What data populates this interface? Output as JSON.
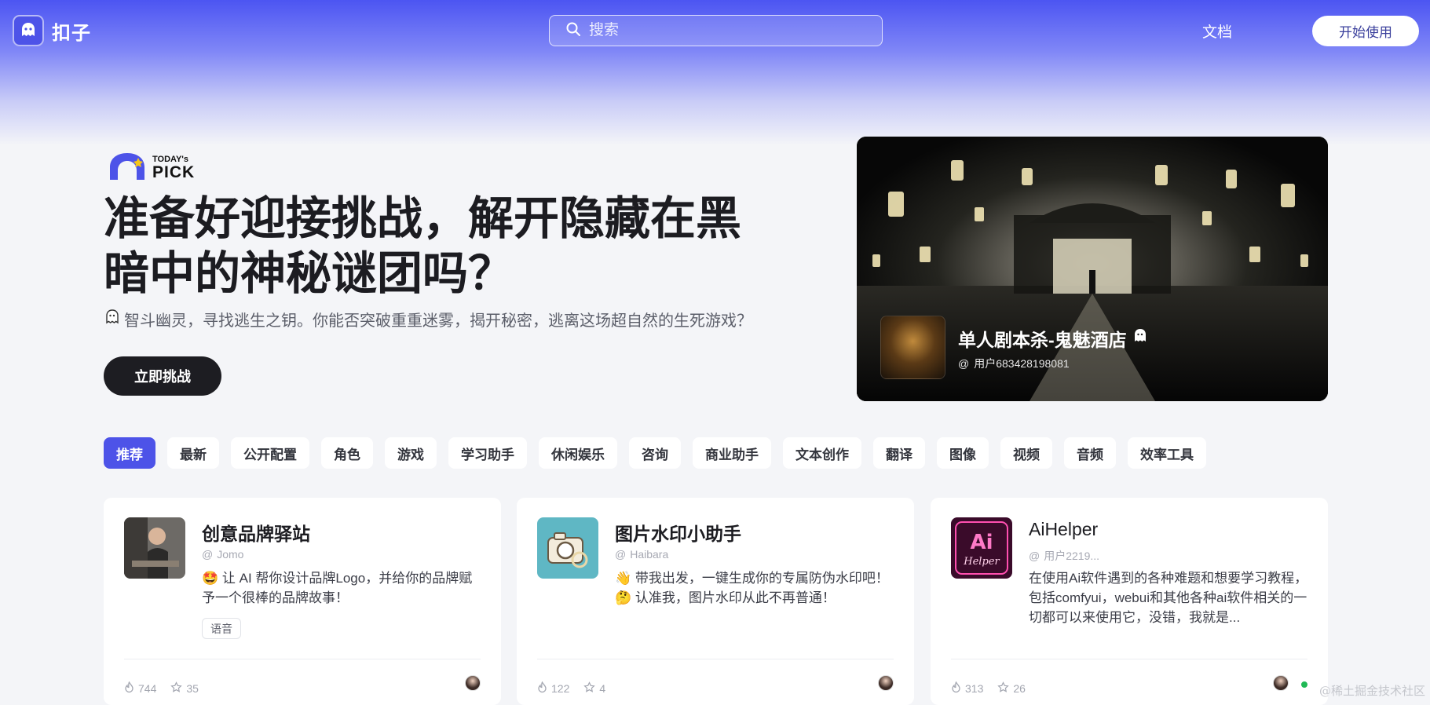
{
  "header": {
    "logo_text": "扣子",
    "search_placeholder": "搜索",
    "docs_label": "文档",
    "start_label": "开始使用"
  },
  "hero": {
    "badge_small": "TODAY's",
    "badge_big": "PICK",
    "title": "准备好迎接挑战，解开隐藏在黑暗中的神秘谜团吗？",
    "description": "智斗幽灵，寻找逃生之钥。你能否突破重重迷雾，揭开秘密，逃离这场超自然的生死游戏？",
    "cta_label": "立即挑战",
    "featured_title": "单人剧本杀-鬼魅酒店",
    "featured_author": "用户683428198081"
  },
  "tabs": [
    "推荐",
    "最新",
    "公开配置",
    "角色",
    "游戏",
    "学习助手",
    "休闲娱乐",
    "咨询",
    "商业助手",
    "文本创作",
    "翻译",
    "图像",
    "视频",
    "音频",
    "效率工具"
  ],
  "cards": [
    {
      "title": "创意品牌驿站",
      "author": "Jomo",
      "desc": "🤩 让 AI 帮你设计品牌Logo，并给你的品牌赋予一个很棒的品牌故事！",
      "tag": "语音",
      "stats": {
        "heat": "744",
        "stars": "35"
      }
    },
    {
      "title": "图片水印小助手",
      "author": "Haibara",
      "desc": "👋 带我出发，一键生成你的专属防伪水印吧！ 🤔 认准我，图片水印从此不再普通！",
      "tag": "",
      "stats": {
        "heat": "122",
        "stars": "4"
      }
    },
    {
      "title": "AiHelper",
      "author": "用户2219...",
      "desc": "在使用Ai软件遇到的各种难题和想要学习教程，包括comfyui，webui和其他各种ai软件相关的一切都可以来使用它，没错，我就是...",
      "tag": "",
      "stats": {
        "heat": "313",
        "stars": "26"
      }
    }
  ],
  "watermark": "@稀土掘金技术社区",
  "colors": {
    "brand": "#4d53e8",
    "dark": "#1d1d22"
  }
}
